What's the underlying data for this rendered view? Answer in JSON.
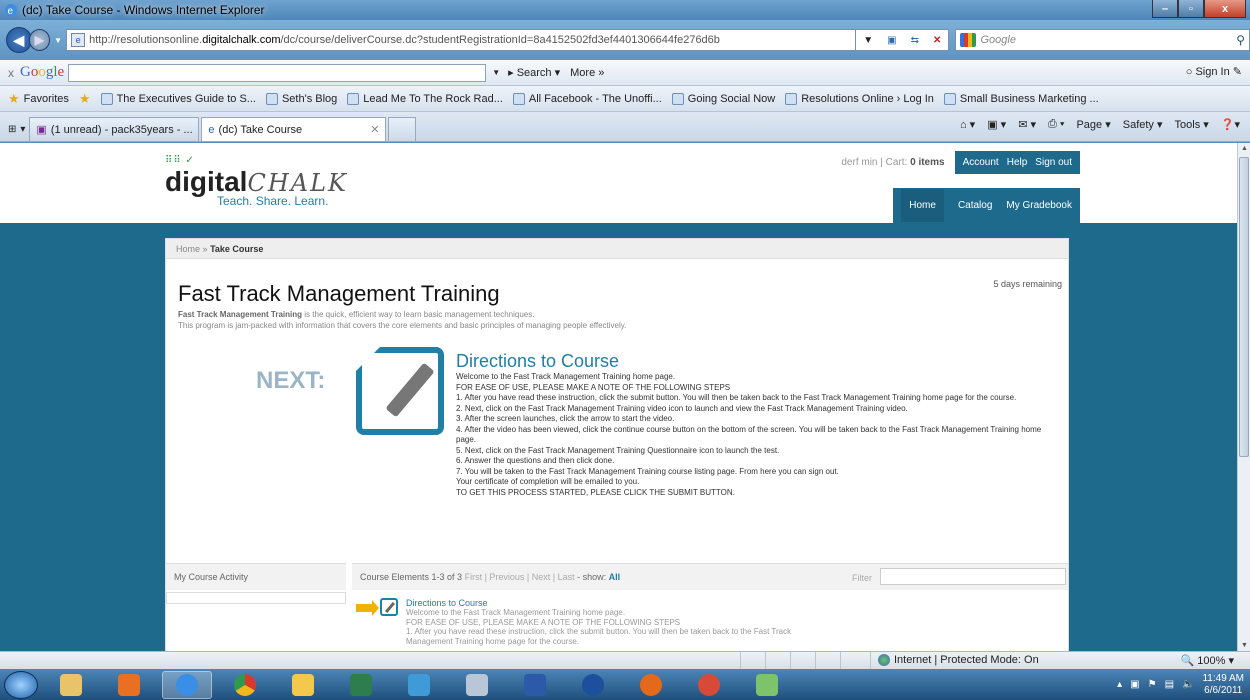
{
  "window": {
    "title": "(dc) Take Course - Windows Internet Explorer",
    "buttons": [
      "–",
      "▫",
      "x"
    ]
  },
  "addressbar": {
    "url_prefix": "http://resolutionsonline.",
    "url_host": "digitalchalk.com",
    "url_rest": "/dc/course/deliverCourse.dc?studentRegistrationId=8a4152502fd3ef4401306644fe276d6b",
    "search_placeholder": "Google"
  },
  "google_toolbar": {
    "close": "x",
    "brand": [
      "G",
      "o",
      "o",
      "g",
      "l",
      "e"
    ],
    "search_value": "",
    "search_button": "Search",
    "more": "More »",
    "sign_in": "Sign In"
  },
  "favorites": {
    "label": "Favorites",
    "items": [
      "The Executives Guide to S...",
      "Seth's Blog",
      "Lead Me To The Rock Rad...",
      "All Facebook - The Unoffi...",
      "Going Social Now",
      "Resolutions Online › Log In",
      "Small Business Marketing ..."
    ]
  },
  "tabs": [
    {
      "label": "(1 unread) - pack35years - ..."
    },
    {
      "label": "(dc) Take Course"
    }
  ],
  "commandbar": [
    "Page ▾",
    "Safety ▾",
    "Tools ▾"
  ],
  "site": {
    "logo_word": "digital",
    "logo_chalk": "CHALK",
    "tagline": "Teach. Share. Learn.",
    "user": "derf min",
    "cart_label": "Cart:",
    "cart_value": "0 items",
    "account_links": [
      "Account",
      "Help",
      "Sign out"
    ],
    "nav": [
      "Home",
      "Catalog",
      "My Gradebook"
    ]
  },
  "breadcrumb": {
    "home": "Home",
    "sep": "»",
    "current": "Take Course"
  },
  "course": {
    "days_remaining": "5 days remaining",
    "title": "Fast Track Management Training",
    "desc_bold": "Fast Track Management Training",
    "desc_rest": " is the quick, efficient way to learn basic management techniques.",
    "desc_line2": "This program is jam-packed with information that covers the core elements and basic principles of managing people effectively."
  },
  "next": {
    "label": "NEXT:",
    "title": "Directions to Course",
    "lines": [
      "Welcome to the Fast Track Management Training home page.",
      "FOR EASE OF USE, PLEASE MAKE A NOTE OF THE FOLLOWING STEPS",
      "1. After you have read these instruction, click the submit button. You will then be taken back to the Fast Track Management Training home page for the course.",
      "2. Next, click on the Fast Track Management Training video icon to launch and view the Fast Track Management Training video.",
      "3. After the screen launches, click the arrow to start the video.",
      "4. After the video has been viewed, click the continue course button on the bottom of the screen. You will be taken back to the Fast Track Management Training home page.",
      "5. Next, click on the Fast Track Management Training Questionnaire icon to launch the test.",
      "6. Answer the questions and then click done.",
      "7. You will be taken to the Fast Track Management Training course listing page. From here you can sign out.",
      "Your certificate of completion will be emailed to you.",
      "TO GET THIS PROCESS STARTED, PLEASE CLICK THE SUBMIT BUTTON."
    ]
  },
  "activity": {
    "header": "My Course Activity"
  },
  "elements": {
    "header": "Course Elements 1-3 of 3",
    "pager": "First | Previous | Next | Last",
    "show_label": "- show:",
    "show_value": "All",
    "filter_label": "Filter",
    "filter_value": "",
    "item_title": "Directions to Course",
    "item_lines": [
      "Welcome to the Fast Track Management Training home page.",
      "FOR EASE OF USE, PLEASE MAKE A NOTE OF THE FOLLOWING STEPS",
      "1. After you have read these instruction, click the submit button. You will then be taken back to the Fast Track",
      "Management Training home page for the course."
    ]
  },
  "statusbar": {
    "zone": "Internet | Protected Mode: On",
    "zoom": "100%"
  },
  "taskbar": {
    "time": "11:49 AM",
    "date": "6/6/2011"
  }
}
